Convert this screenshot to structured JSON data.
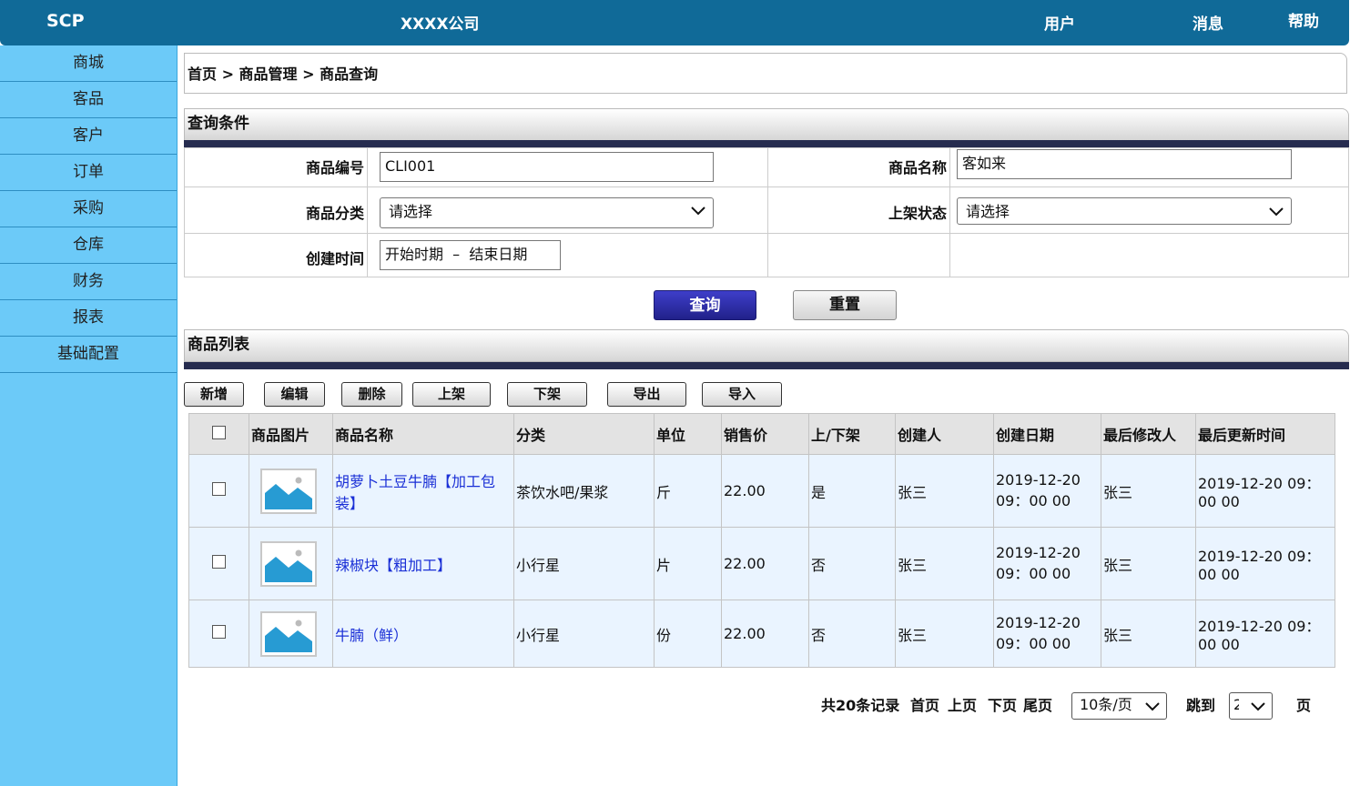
{
  "header": {
    "logo": "SCP",
    "company": "XXXX公司",
    "user": "用户",
    "messages": "消息",
    "help": "帮助"
  },
  "sidebar": {
    "items": [
      "商城",
      "客品",
      "客户",
      "订单",
      "采购",
      "仓库",
      "财务",
      "报表",
      "基础配置"
    ]
  },
  "breadcrumb": "首页 > 商品管理 > 商品查询",
  "query": {
    "title": "查询条件",
    "code_label": "商品编号",
    "code_value": "CLI001",
    "name_label": "商品名称",
    "name_value": "客如来",
    "category_label": "商品分类",
    "category_value": "请选择",
    "status_label": "上架状态",
    "status_value": "请选择",
    "created_label": "创建时间",
    "created_value": "开始时期  –  结束日期",
    "search_button": "查询",
    "reset_button": "重置"
  },
  "list": {
    "title": "商品列表",
    "toolbar": [
      "新增",
      "编辑",
      "删除",
      "上架",
      "下架",
      "导出",
      "导入"
    ],
    "columns": [
      "商品图片",
      "商品名称",
      "分类",
      "单位",
      "销售价",
      "上/下架",
      "创建人",
      "创建日期",
      "最后修改人",
      "最后更新时间"
    ],
    "rows": [
      {
        "name": "胡萝卜土豆牛腩【加工包装】",
        "category": "茶饮水吧/果浆",
        "unit": "斤",
        "price": "22.00",
        "listed": "是",
        "creator": "张三",
        "created": "2019-12-20 09：00 00",
        "modifier": "张三",
        "updated": "2019-12-20 09：00 00"
      },
      {
        "name": "辣椒块【粗加工】",
        "category": "小行星",
        "unit": "片",
        "price": "22.00",
        "listed": "否",
        "creator": "张三",
        "created": "2019-12-20 09：00 00",
        "modifier": "张三",
        "updated": "2019-12-20 09：00 00"
      },
      {
        "name": "牛腩（鲜）",
        "category": "小行星",
        "unit": "份",
        "price": "22.00",
        "listed": "否",
        "creator": "张三",
        "created": "2019-12-20 09：00 00",
        "modifier": "张三",
        "updated": "2019-12-20 09：00 00"
      }
    ]
  },
  "pager": {
    "total": "共20条记录",
    "first": "首页",
    "prev": "上页",
    "next": "下页",
    "last": "尾页",
    "page_size": "10条/页",
    "jump_label": "跳到",
    "jump_value": "2",
    "page_suffix": "页"
  },
  "colors": {
    "topbar": "#106a98",
    "sidebar": "#6ccaf8",
    "section_bar": "#262c4f",
    "link": "#1a2fd6",
    "row_bg": "#eaf4ff"
  }
}
